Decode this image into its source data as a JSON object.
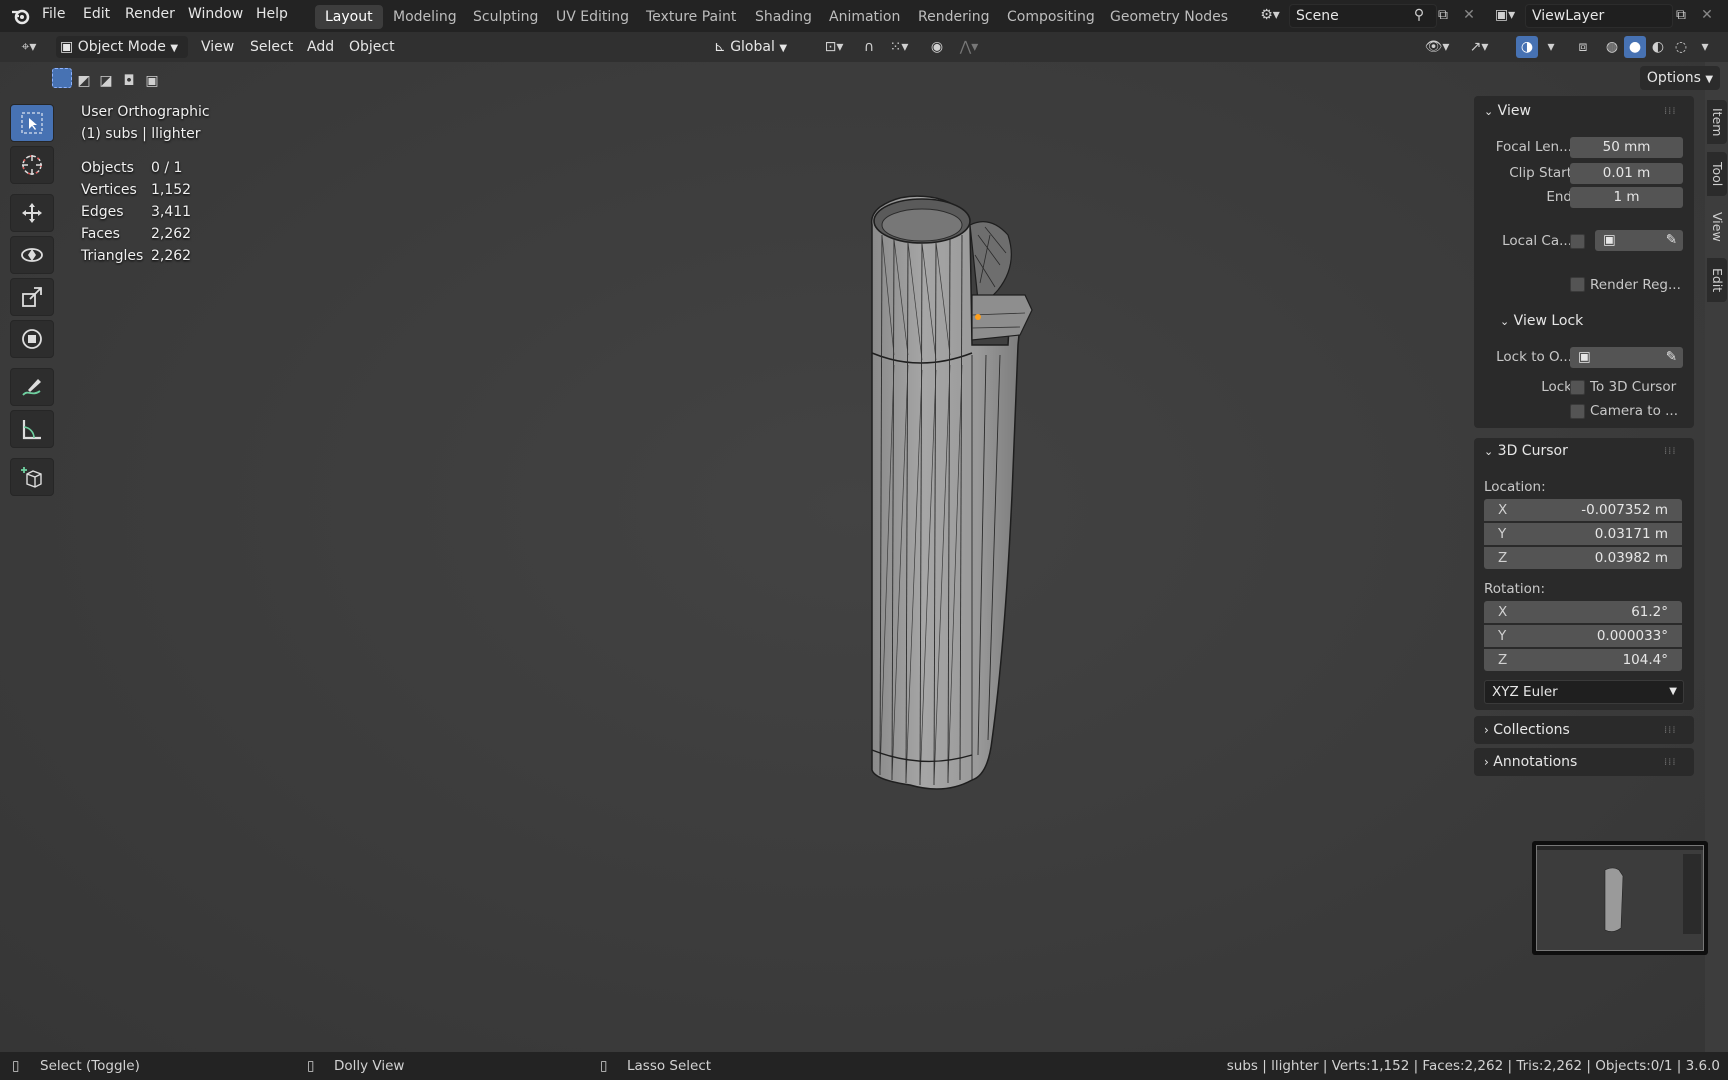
{
  "menu": {
    "file": "File",
    "edit": "Edit",
    "render": "Render",
    "window": "Window",
    "help": "Help"
  },
  "workspaces": [
    "Layout",
    "Modeling",
    "Sculpting",
    "UV Editing",
    "Texture Paint",
    "Shading",
    "Animation",
    "Rendering",
    "Compositing",
    "Geometry Nodes"
  ],
  "active_workspace": "Layout",
  "scene": {
    "name": "Scene"
  },
  "view_layer": {
    "name": "ViewLayer"
  },
  "header": {
    "mode": "Object Mode",
    "view": "View",
    "select": "Select",
    "add": "Add",
    "object": "Object",
    "orientation": "Global",
    "options": "Options"
  },
  "overlay": {
    "view_name": "User Orthographic",
    "collection": "(1) subs | llighter",
    "stats": [
      {
        "label": "Objects",
        "value": "0 / 1"
      },
      {
        "label": "Vertices",
        "value": "1,152"
      },
      {
        "label": "Edges",
        "value": "3,411"
      },
      {
        "label": "Faces",
        "value": "2,262"
      },
      {
        "label": "Triangles",
        "value": "2,262"
      }
    ]
  },
  "npanel": {
    "tabs": [
      "Item",
      "Tool",
      "View",
      "Edit"
    ],
    "active_tab": "View",
    "view": {
      "title": "View",
      "focal_label": "Focal Len...",
      "focal_value": "50 mm",
      "clip_start_label": "Clip Start",
      "clip_start_value": "0.01 m",
      "end_label": "End",
      "end_value": "1 m",
      "local_camera_label": "Local Ca...",
      "render_region": "Render Reg..."
    },
    "view_lock": {
      "title": "View Lock",
      "lock_to_object_label": "Lock to O...",
      "lock_label": "Lock",
      "to_3d_cursor": "To 3D Cursor",
      "camera_to_view": "Camera to ..."
    },
    "cursor": {
      "title": "3D Cursor",
      "location_label": "Location:",
      "location": [
        {
          "axis": "X",
          "value": "-0.007352 m"
        },
        {
          "axis": "Y",
          "value": "0.03171 m"
        },
        {
          "axis": "Z",
          "value": "0.03982 m"
        }
      ],
      "rotation_label": "Rotation:",
      "rotation": [
        {
          "axis": "X",
          "value": "61.2°"
        },
        {
          "axis": "Y",
          "value": "0.000033°"
        },
        {
          "axis": "Z",
          "value": "104.4°"
        }
      ],
      "rotation_mode": "XYZ Euler"
    },
    "collections": "Collections",
    "annotations": "Annotations"
  },
  "statusbar": {
    "select": "Select (Toggle)",
    "dolly": "Dolly View",
    "lasso": "Lasso Select",
    "info": "subs | llighter | Verts:1,152 | Faces:2,262 | Tris:2,262 | Objects:0/1 | 3.6.0"
  },
  "colors": {
    "accent": "#4772b3",
    "selected_vertex": "#ff9f1a"
  }
}
